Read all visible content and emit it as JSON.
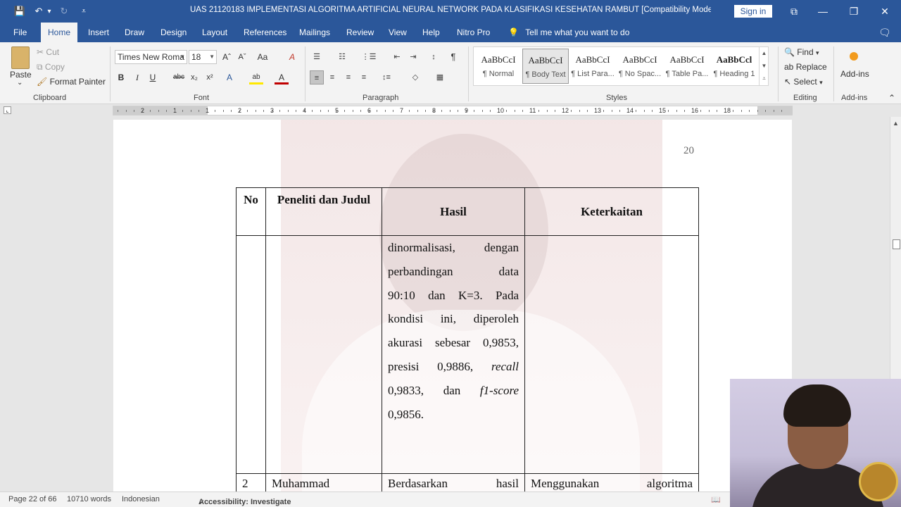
{
  "window": {
    "title": "UAS 21120183 IMPLEMENTASI ALGORITMA ARTIFICIAL NEURAL NETWORK PADA KLASIFIKASI KESEHATAN RAMBUT [Compatibility Mode]  -  Word",
    "sign_in": "Sign in",
    "controls": {
      "ribbon_display": "⧉",
      "minimize": "—",
      "restore": "❐",
      "close": "✕"
    },
    "quick_access": {
      "save": "💾",
      "undo": "↶",
      "undo_dropdown": "▾",
      "redo": "↻",
      "customize": "⩡"
    }
  },
  "tabs": [
    "File",
    "Home",
    "Insert",
    "Draw",
    "Design",
    "Layout",
    "References",
    "Mailings",
    "Review",
    "View",
    "Help",
    "Nitro Pro"
  ],
  "active_tab": "Home",
  "tell_me": {
    "icon": "💡",
    "placeholder": "Tell me what you want to do"
  },
  "comments_icon": "🗨",
  "ribbon": {
    "clipboard": {
      "paste": "Paste",
      "paste_dropdown": "⌄",
      "cut": "Cut",
      "copy": "Copy",
      "format_painter": "Format Painter",
      "label": "Clipboard"
    },
    "font": {
      "family": "Times New Roma",
      "size": "18",
      "grow": "Aˆ",
      "shrink": "Aˇ",
      "change_case": "Aa",
      "clear_formatting": "A",
      "bold": "B",
      "italic": "I",
      "underline": "U",
      "strikethrough": "abc",
      "subscript": "x₂",
      "superscript": "x²",
      "effects": "A",
      "highlight": "ab",
      "font_color": "A",
      "label": "Font"
    },
    "paragraph": {
      "bullets": "☰",
      "numbering": "☷",
      "multilevel": "⋮☰",
      "decrease_indent": "⇤",
      "increase_indent": "⇥",
      "sort": "↕",
      "show_marks": "¶",
      "align_left": "≡",
      "align_center": "≡",
      "align_right": "≡",
      "justify": "≡",
      "line_spacing": "↕≡",
      "shading": "◇",
      "borders": "▦",
      "label": "Paragraph"
    },
    "styles": {
      "items": [
        {
          "sample": "AaBbCcI",
          "name": "¶ Normal"
        },
        {
          "sample": "AaBbCcI",
          "name": "¶ Body Text"
        },
        {
          "sample": "AaBbCcI",
          "name": "¶ List Para..."
        },
        {
          "sample": "AaBbCcI",
          "name": "¶ No Spac..."
        },
        {
          "sample": "AaBbCcI",
          "name": "¶ Table Pa..."
        },
        {
          "sample": "AaBbCcl",
          "name": "¶ Heading 1"
        }
      ],
      "selected_index": 1,
      "label": "Styles"
    },
    "editing": {
      "find": "Find",
      "replace": "Replace",
      "select": "Select",
      "label": "Editing"
    },
    "addins": {
      "button": "Add-ins",
      "label": "Add-ins"
    }
  },
  "ruler": {
    "numbers": [
      "2",
      "1",
      "1",
      "2",
      "3",
      "4",
      "5",
      "6",
      "7",
      "8",
      "9",
      "10",
      "11",
      "12",
      "13",
      "14",
      "15",
      "16",
      "18"
    ]
  },
  "document": {
    "page_number": "20",
    "table": {
      "headers": {
        "no": "No",
        "peneliti": "Peneliti dan Judul",
        "hasil": "Hasil",
        "keterkaitan": "Keterkaitan"
      },
      "row1": {
        "no": "",
        "peneliti": "",
        "hasil_lines": [
          "dinormalisasi, dengan",
          "perbandingan data",
          "90:10 dan K=3. Pada",
          "kondisi ini, diperoleh",
          "akurasi sebesar 0,9853,"
        ],
        "hasil_line6_a": "presisi 0,9886, ",
        "hasil_line6_recall": "recall",
        "hasil_line7_a": "0,9833, dan ",
        "hasil_line7_f1": "f1-score",
        "hasil_line8": "0,9856.",
        "keterkaitan": ""
      },
      "row2": {
        "no": "2",
        "peneliti": "Muhammad",
        "hasil": "Berdasarkan hasil",
        "keterkaitan": "Menggunakan algoritma"
      }
    }
  },
  "statusbar": {
    "page": "Page 22 of 66",
    "words": "10710 words",
    "language": "Indonesian",
    "accessibility": "Accessibility: Investigate",
    "read_mode_icon": "📖"
  }
}
